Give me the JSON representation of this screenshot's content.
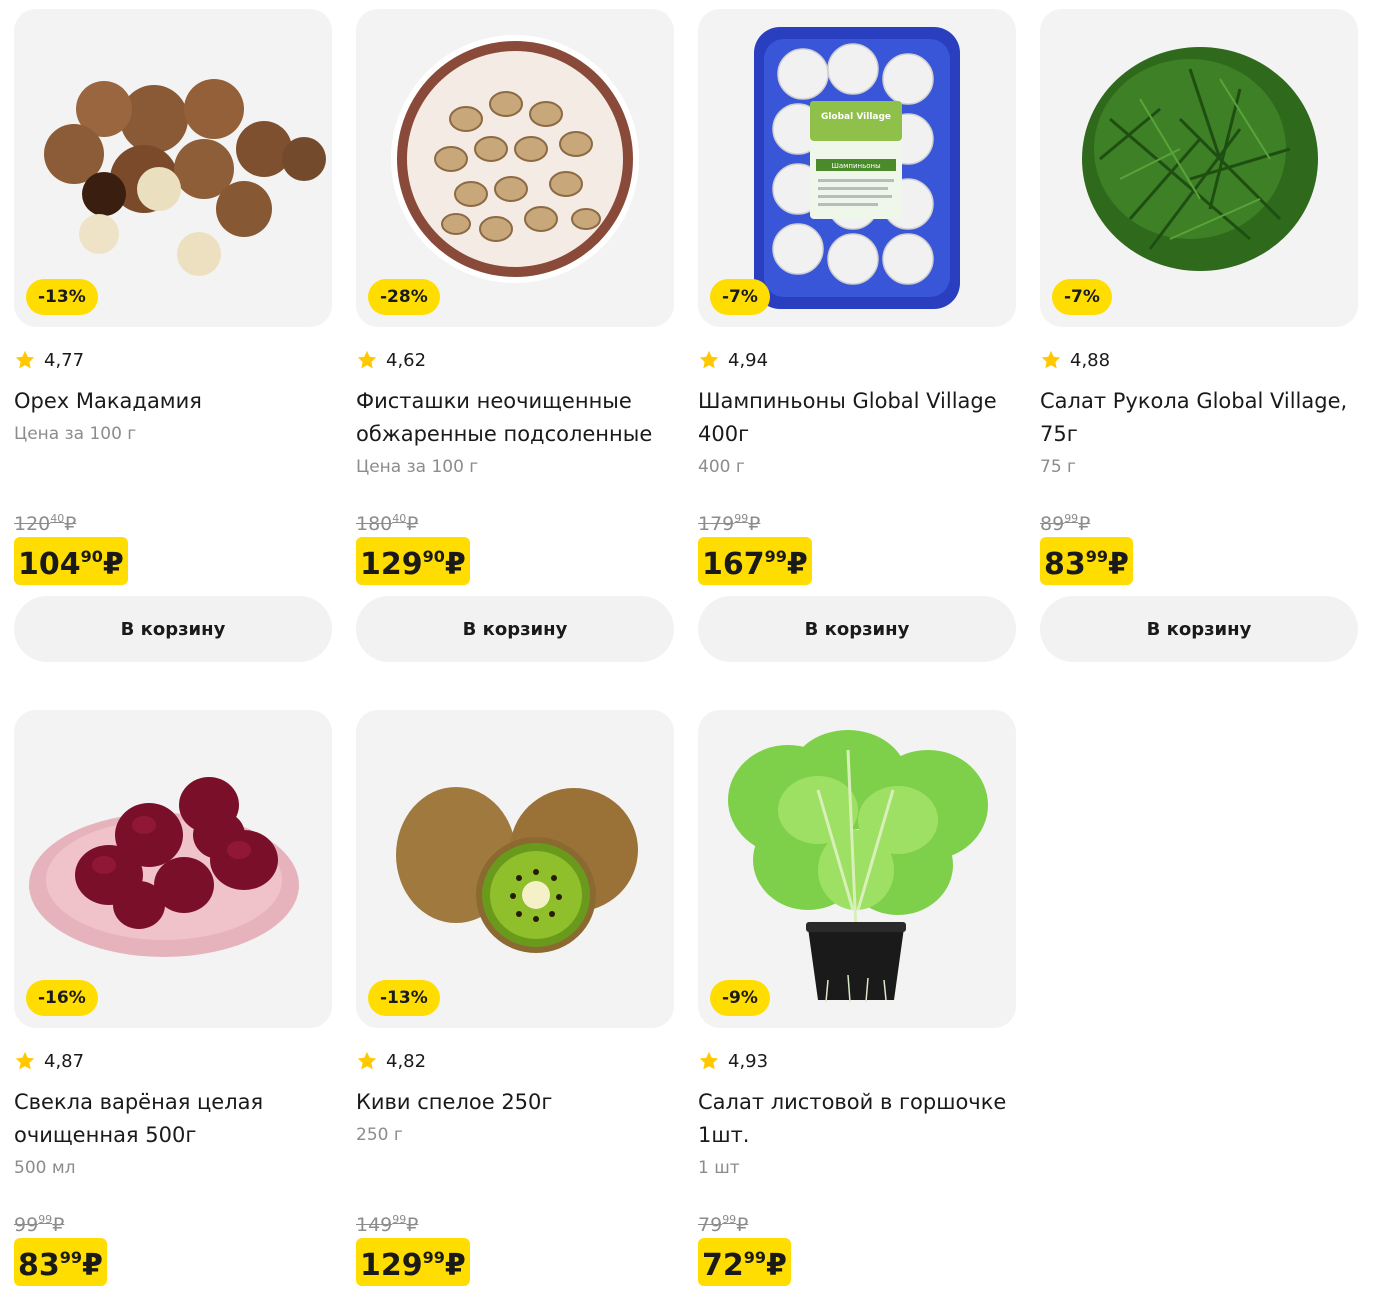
{
  "products": [
    {
      "discount": "-13%",
      "rating": "4,77",
      "name": "Орех Макадамия",
      "unit": "Цена за 100 г",
      "old_int": "120",
      "old_frac": "40",
      "new_int": "104",
      "new_frac": "90",
      "currency": "₽",
      "button": "В корзину"
    },
    {
      "discount": "-28%",
      "rating": "4,62",
      "name": "Фисташки неочищенные обжаренные подсоленные",
      "unit": "Цена за 100 г",
      "old_int": "180",
      "old_frac": "40",
      "new_int": "129",
      "new_frac": "90",
      "currency": "₽",
      "button": "В корзину"
    },
    {
      "discount": "-7%",
      "rating": "4,94",
      "name": "Шампиньоны Global Village 400г",
      "unit": "400 г",
      "old_int": "179",
      "old_frac": "99",
      "new_int": "167",
      "new_frac": "99",
      "currency": "₽",
      "button": "В корзину",
      "label_brand": "Global Village",
      "label_text": "Шампиньоны"
    },
    {
      "discount": "-7%",
      "rating": "4,88",
      "name": "Салат Рукола Global Village, 75г",
      "unit": "75 г",
      "old_int": "89",
      "old_frac": "99",
      "new_int": "83",
      "new_frac": "99",
      "currency": "₽",
      "button": "В корзину"
    },
    {
      "discount": "-16%",
      "rating": "4,87",
      "name": "Свекла варёная целая очищенная 500г",
      "unit": "500 мл",
      "old_int": "99",
      "old_frac": "99",
      "new_int": "83",
      "new_frac": "99",
      "currency": "₽",
      "button": ""
    },
    {
      "discount": "-13%",
      "rating": "4,82",
      "name": "Киви спелое 250г",
      "unit": "250 г",
      "old_int": "149",
      "old_frac": "99",
      "new_int": "129",
      "new_frac": "99",
      "currency": "₽",
      "button": ""
    },
    {
      "discount": "-9%",
      "rating": "4,93",
      "name": "Салат листовой в горшочке 1шт.",
      "unit": "1 шт",
      "old_int": "79",
      "old_frac": "99",
      "new_int": "72",
      "new_frac": "99",
      "currency": "₽",
      "button": ""
    }
  ],
  "colors": {
    "accent": "#ffdd00",
    "card_bg": "#f3f3f3",
    "button_bg": "#f2f2f2",
    "muted_text": "#8c8c8c",
    "star": "#ffc800"
  },
  "icons": {
    "rating": "star-icon"
  }
}
